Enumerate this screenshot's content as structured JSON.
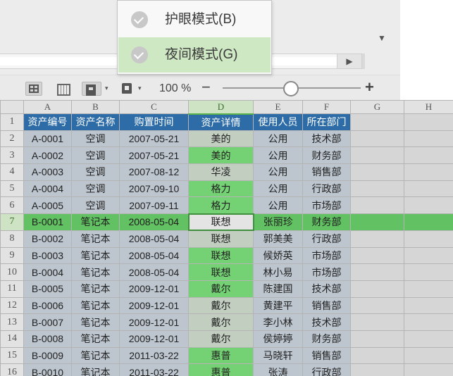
{
  "menu": {
    "items": [
      {
        "label": "护眼模式(B)",
        "selected": false
      },
      {
        "label": "夜间模式(G)",
        "selected": true
      }
    ]
  },
  "status_bar": {
    "zoom_text": "100 %",
    "zoom_minus": "−",
    "zoom_plus": "+",
    "dropdown_glyph": "▾",
    "scroll_right_glyph": "▶",
    "drop_arrow_glyph": "▼"
  },
  "sheet": {
    "column_letters": [
      "A",
      "B",
      "C",
      "D",
      "E",
      "F",
      "G",
      "H"
    ],
    "row_numbers": [
      "1",
      "2",
      "3",
      "4",
      "5",
      "6",
      "7",
      "8",
      "9",
      "10",
      "11",
      "12",
      "13",
      "14",
      "15",
      "16"
    ],
    "selected_row": "7",
    "selected_column": "D",
    "header": [
      "资产编号",
      "资产名称",
      "购置时间",
      "资产详情",
      "使用人员",
      "所在部门"
    ],
    "rows": [
      [
        "A-0001",
        "空调",
        "2007-05-21",
        "美的",
        "公用",
        "技术部"
      ],
      [
        "A-0002",
        "空调",
        "2007-05-21",
        "美的",
        "公用",
        "财务部"
      ],
      [
        "A-0003",
        "空调",
        "2007-08-12",
        "华凌",
        "公用",
        "销售部"
      ],
      [
        "A-0004",
        "空调",
        "2007-09-10",
        "格力",
        "公用",
        "行政部"
      ],
      [
        "A-0005",
        "空调",
        "2007-09-11",
        "格力",
        "公用",
        "市场部"
      ],
      [
        "B-0001",
        "笔记本",
        "2008-05-04",
        "联想",
        "张丽珍",
        "财务部"
      ],
      [
        "B-0002",
        "笔记本",
        "2008-05-04",
        "联想",
        "郭美美",
        "行政部"
      ],
      [
        "B-0003",
        "笔记本",
        "2008-05-04",
        "联想",
        "候娇英",
        "市场部"
      ],
      [
        "B-0004",
        "笔记本",
        "2008-05-04",
        "联想",
        "林小易",
        "市场部"
      ],
      [
        "B-0005",
        "笔记本",
        "2009-12-01",
        "戴尔",
        "陈建国",
        "技术部"
      ],
      [
        "B-0006",
        "笔记本",
        "2009-12-01",
        "戴尔",
        "黄建平",
        "销售部"
      ],
      [
        "B-0007",
        "笔记本",
        "2009-12-01",
        "戴尔",
        "李小林",
        "技术部"
      ],
      [
        "B-0008",
        "笔记本",
        "2009-12-01",
        "戴尔",
        "侯婷婷",
        "财务部"
      ],
      [
        "B-0009",
        "笔记本",
        "2011-03-22",
        "惠普",
        "马晓轩",
        "销售部"
      ],
      [
        "B-0010",
        "笔记本",
        "2011-03-22",
        "惠普",
        "张涛",
        "行政部"
      ]
    ],
    "highlighted_d_rows": [
      2,
      4,
      5,
      8,
      9,
      10,
      14,
      15
    ]
  }
}
